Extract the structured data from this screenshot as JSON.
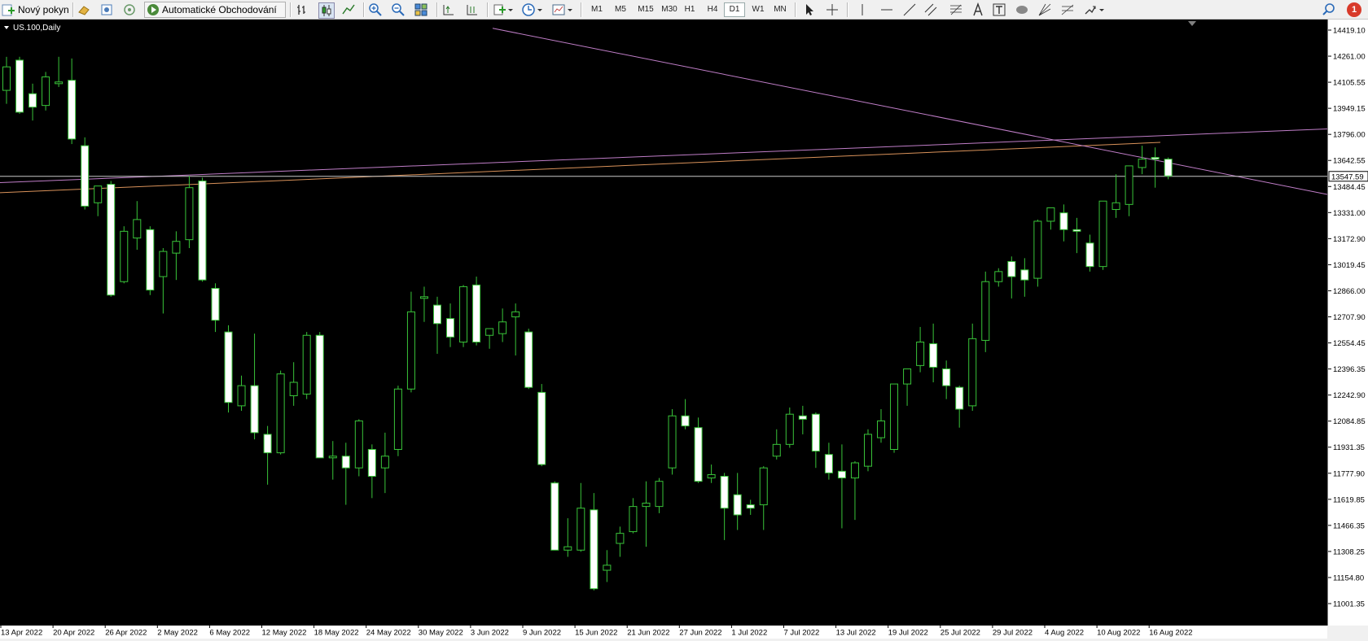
{
  "toolbar": {
    "new_order_label": "Nový pokyn",
    "auto_trading_label": "Automatické Obchodování",
    "timeframes": [
      "M1",
      "M5",
      "M15",
      "M30",
      "H1",
      "H4",
      "D1",
      "W1",
      "MN"
    ],
    "active_timeframe": "D1",
    "notification_count": "1"
  },
  "chart_data": {
    "type": "candlestick",
    "symbol_label": "US.100,Daily",
    "current_price": "13547.59",
    "price_axis_labels": [
      "14419.10",
      "14261.00",
      "14105.55",
      "13949.15",
      "13796.00",
      "13642.55",
      "13484.45",
      "13331.00",
      "13172.90",
      "13019.45",
      "12866.00",
      "12707.90",
      "12554.45",
      "12396.35",
      "12242.90",
      "12084.85",
      "11931.35",
      "11777.90",
      "11619.85",
      "11466.35",
      "11308.25",
      "11154.80",
      "11001.35"
    ],
    "date_axis_labels": [
      "13 Apr 2022",
      "20 Apr 2022",
      "26 Apr 2022",
      "2 May 2022",
      "6 May 2022",
      "12 May 2022",
      "18 May 2022",
      "24 May 2022",
      "30 May 2022",
      "3 Jun 2022",
      "9 Jun 2022",
      "15 Jun 2022",
      "21 Jun 2022",
      "27 Jun 2022",
      "1 Jul 2022",
      "7 Jul 2022",
      "13 Jul 2022",
      "19 Jul 2022",
      "25 Jul 2022",
      "29 Jul 2022",
      "4 Aug 2022",
      "10 Aug 2022",
      "16 Aug 2022"
    ],
    "candles": [
      {
        "o": 14060,
        "h": 14260,
        "l": 13980,
        "c": 14200
      },
      {
        "o": 14240,
        "h": 14260,
        "l": 13920,
        "c": 13930
      },
      {
        "o": 14040,
        "h": 14100,
        "l": 13880,
        "c": 13960
      },
      {
        "o": 13970,
        "h": 14170,
        "l": 13940,
        "c": 14140
      },
      {
        "o": 14100,
        "h": 14260,
        "l": 14080,
        "c": 14110
      },
      {
        "o": 14120,
        "h": 14250,
        "l": 13740,
        "c": 13770
      },
      {
        "o": 13730,
        "h": 13780,
        "l": 13350,
        "c": 13370
      },
      {
        "o": 13390,
        "h": 13490,
        "l": 13310,
        "c": 13490
      },
      {
        "o": 13500,
        "h": 13520,
        "l": 12830,
        "c": 12840
      },
      {
        "o": 12920,
        "h": 13250,
        "l": 12910,
        "c": 13220
      },
      {
        "o": 13180,
        "h": 13400,
        "l": 13110,
        "c": 13290
      },
      {
        "o": 13230,
        "h": 13250,
        "l": 12840,
        "c": 12870
      },
      {
        "o": 12950,
        "h": 13120,
        "l": 12730,
        "c": 13100
      },
      {
        "o": 13090,
        "h": 13220,
        "l": 12930,
        "c": 13160
      },
      {
        "o": 13170,
        "h": 13550,
        "l": 13120,
        "c": 13480
      },
      {
        "o": 13520,
        "h": 13540,
        "l": 12920,
        "c": 12930
      },
      {
        "o": 12880,
        "h": 12910,
        "l": 12620,
        "c": 12690
      },
      {
        "o": 12620,
        "h": 12660,
        "l": 12140,
        "c": 12200
      },
      {
        "o": 12180,
        "h": 12360,
        "l": 12150,
        "c": 12300
      },
      {
        "o": 12300,
        "h": 12610,
        "l": 11980,
        "c": 12020
      },
      {
        "o": 12010,
        "h": 12060,
        "l": 11710,
        "c": 11900
      },
      {
        "o": 11900,
        "h": 12390,
        "l": 11890,
        "c": 12370
      },
      {
        "o": 12240,
        "h": 12440,
        "l": 12180,
        "c": 12320
      },
      {
        "o": 12250,
        "h": 12620,
        "l": 12220,
        "c": 12600
      },
      {
        "o": 12600,
        "h": 12620,
        "l": 11870,
        "c": 11870
      },
      {
        "o": 11870,
        "h": 11970,
        "l": 11740,
        "c": 11880
      },
      {
        "o": 11880,
        "h": 11960,
        "l": 11590,
        "c": 11810
      },
      {
        "o": 11810,
        "h": 12100,
        "l": 11760,
        "c": 12090
      },
      {
        "o": 11920,
        "h": 11950,
        "l": 11630,
        "c": 11760
      },
      {
        "o": 11810,
        "h": 12020,
        "l": 11660,
        "c": 11880
      },
      {
        "o": 11920,
        "h": 12300,
        "l": 11880,
        "c": 12280
      },
      {
        "o": 12280,
        "h": 12860,
        "l": 12260,
        "c": 12740
      },
      {
        "o": 12830,
        "h": 12890,
        "l": 12680,
        "c": 12830
      },
      {
        "o": 12780,
        "h": 12830,
        "l": 12490,
        "c": 12670
      },
      {
        "o": 12700,
        "h": 12790,
        "l": 12530,
        "c": 12590
      },
      {
        "o": 12560,
        "h": 12900,
        "l": 12530,
        "c": 12890
      },
      {
        "o": 12900,
        "h": 12950,
        "l": 12540,
        "c": 12560
      },
      {
        "o": 12600,
        "h": 12620,
        "l": 12520,
        "c": 12640
      },
      {
        "o": 12610,
        "h": 12760,
        "l": 12560,
        "c": 12680
      },
      {
        "o": 12710,
        "h": 12790,
        "l": 12480,
        "c": 12740
      },
      {
        "o": 12620,
        "h": 12640,
        "l": 12280,
        "c": 12290
      },
      {
        "o": 12260,
        "h": 12310,
        "l": 11820,
        "c": 11830
      },
      {
        "o": 11720,
        "h": 11730,
        "l": 11320,
        "c": 11320
      },
      {
        "o": 11320,
        "h": 11510,
        "l": 11280,
        "c": 11340
      },
      {
        "o": 11320,
        "h": 11720,
        "l": 11310,
        "c": 11570
      },
      {
        "o": 11560,
        "h": 11660,
        "l": 11080,
        "c": 11090
      },
      {
        "o": 11200,
        "h": 11320,
        "l": 11130,
        "c": 11230
      },
      {
        "o": 11360,
        "h": 11460,
        "l": 11280,
        "c": 11420
      },
      {
        "o": 11430,
        "h": 11630,
        "l": 11420,
        "c": 11580
      },
      {
        "o": 11580,
        "h": 11730,
        "l": 11340,
        "c": 11600
      },
      {
        "o": 11580,
        "h": 11750,
        "l": 11540,
        "c": 11730
      },
      {
        "o": 11810,
        "h": 12160,
        "l": 11770,
        "c": 12120
      },
      {
        "o": 12120,
        "h": 12220,
        "l": 12040,
        "c": 12060
      },
      {
        "o": 12050,
        "h": 12110,
        "l": 11720,
        "c": 11730
      },
      {
        "o": 11750,
        "h": 11830,
        "l": 11720,
        "c": 11770
      },
      {
        "o": 11760,
        "h": 11780,
        "l": 11380,
        "c": 11570
      },
      {
        "o": 11650,
        "h": 11780,
        "l": 11440,
        "c": 11530
      },
      {
        "o": 11590,
        "h": 11620,
        "l": 11530,
        "c": 11570
      },
      {
        "o": 11590,
        "h": 11820,
        "l": 11440,
        "c": 11810
      },
      {
        "o": 11880,
        "h": 12040,
        "l": 11860,
        "c": 11950
      },
      {
        "o": 11950,
        "h": 12170,
        "l": 11930,
        "c": 12130
      },
      {
        "o": 12120,
        "h": 12180,
        "l": 12010,
        "c": 12100
      },
      {
        "o": 12130,
        "h": 12140,
        "l": 11810,
        "c": 11910
      },
      {
        "o": 11890,
        "h": 11960,
        "l": 11740,
        "c": 11780
      },
      {
        "o": 11790,
        "h": 11950,
        "l": 11450,
        "c": 11750
      },
      {
        "o": 11750,
        "h": 11850,
        "l": 11500,
        "c": 11840
      },
      {
        "o": 11820,
        "h": 12040,
        "l": 11790,
        "c": 12010
      },
      {
        "o": 11990,
        "h": 12160,
        "l": 11960,
        "c": 12090
      },
      {
        "o": 11920,
        "h": 12290,
        "l": 11900,
        "c": 12310
      },
      {
        "o": 12310,
        "h": 12400,
        "l": 12180,
        "c": 12400
      },
      {
        "o": 12420,
        "h": 12650,
        "l": 12380,
        "c": 12560
      },
      {
        "o": 12550,
        "h": 12670,
        "l": 12320,
        "c": 12410
      },
      {
        "o": 12400,
        "h": 12450,
        "l": 12220,
        "c": 12300
      },
      {
        "o": 12290,
        "h": 12300,
        "l": 12050,
        "c": 12160
      },
      {
        "o": 12180,
        "h": 12670,
        "l": 12150,
        "c": 12580
      },
      {
        "o": 12570,
        "h": 12980,
        "l": 12500,
        "c": 12920
      },
      {
        "o": 12920,
        "h": 13000,
        "l": 12890,
        "c": 12980
      },
      {
        "o": 13040,
        "h": 13070,
        "l": 12820,
        "c": 12950
      },
      {
        "o": 12990,
        "h": 13060,
        "l": 12830,
        "c": 12930
      },
      {
        "o": 12940,
        "h": 13290,
        "l": 12890,
        "c": 13280
      },
      {
        "o": 13280,
        "h": 13350,
        "l": 13230,
        "c": 13360
      },
      {
        "o": 13330,
        "h": 13380,
        "l": 13160,
        "c": 13230
      },
      {
        "o": 13230,
        "h": 13300,
        "l": 13090,
        "c": 13220
      },
      {
        "o": 13150,
        "h": 13200,
        "l": 12980,
        "c": 13010
      },
      {
        "o": 13010,
        "h": 13400,
        "l": 12990,
        "c": 13400
      },
      {
        "o": 13350,
        "h": 13560,
        "l": 13300,
        "c": 13390
      },
      {
        "o": 13380,
        "h": 13610,
        "l": 13310,
        "c": 13610
      },
      {
        "o": 13600,
        "h": 13730,
        "l": 13560,
        "c": 13650
      },
      {
        "o": 13660,
        "h": 13720,
        "l": 13480,
        "c": 13650
      },
      {
        "o": 13650,
        "h": 13660,
        "l": 13530,
        "c": 13550
      }
    ],
    "trendlines": [
      {
        "name": "upper-rising-line",
        "color": "#c07ec8",
        "p1": [
          0,
          13510
        ],
        "p2": [
          1630,
          13830
        ]
      },
      {
        "name": "rising-orange-line",
        "color": "#d9925a",
        "p1": [
          0,
          13450
        ],
        "p2": [
          1425,
          13750
        ]
      },
      {
        "name": "falling-line",
        "color": "#c07ec8",
        "p1": [
          605,
          14430
        ],
        "p2": [
          1630,
          13440
        ]
      },
      {
        "name": "horizontal-line",
        "color": "#c8c8c8",
        "p1": [
          0,
          13547.59
        ],
        "p2": [
          1630,
          13547.59
        ]
      }
    ]
  }
}
